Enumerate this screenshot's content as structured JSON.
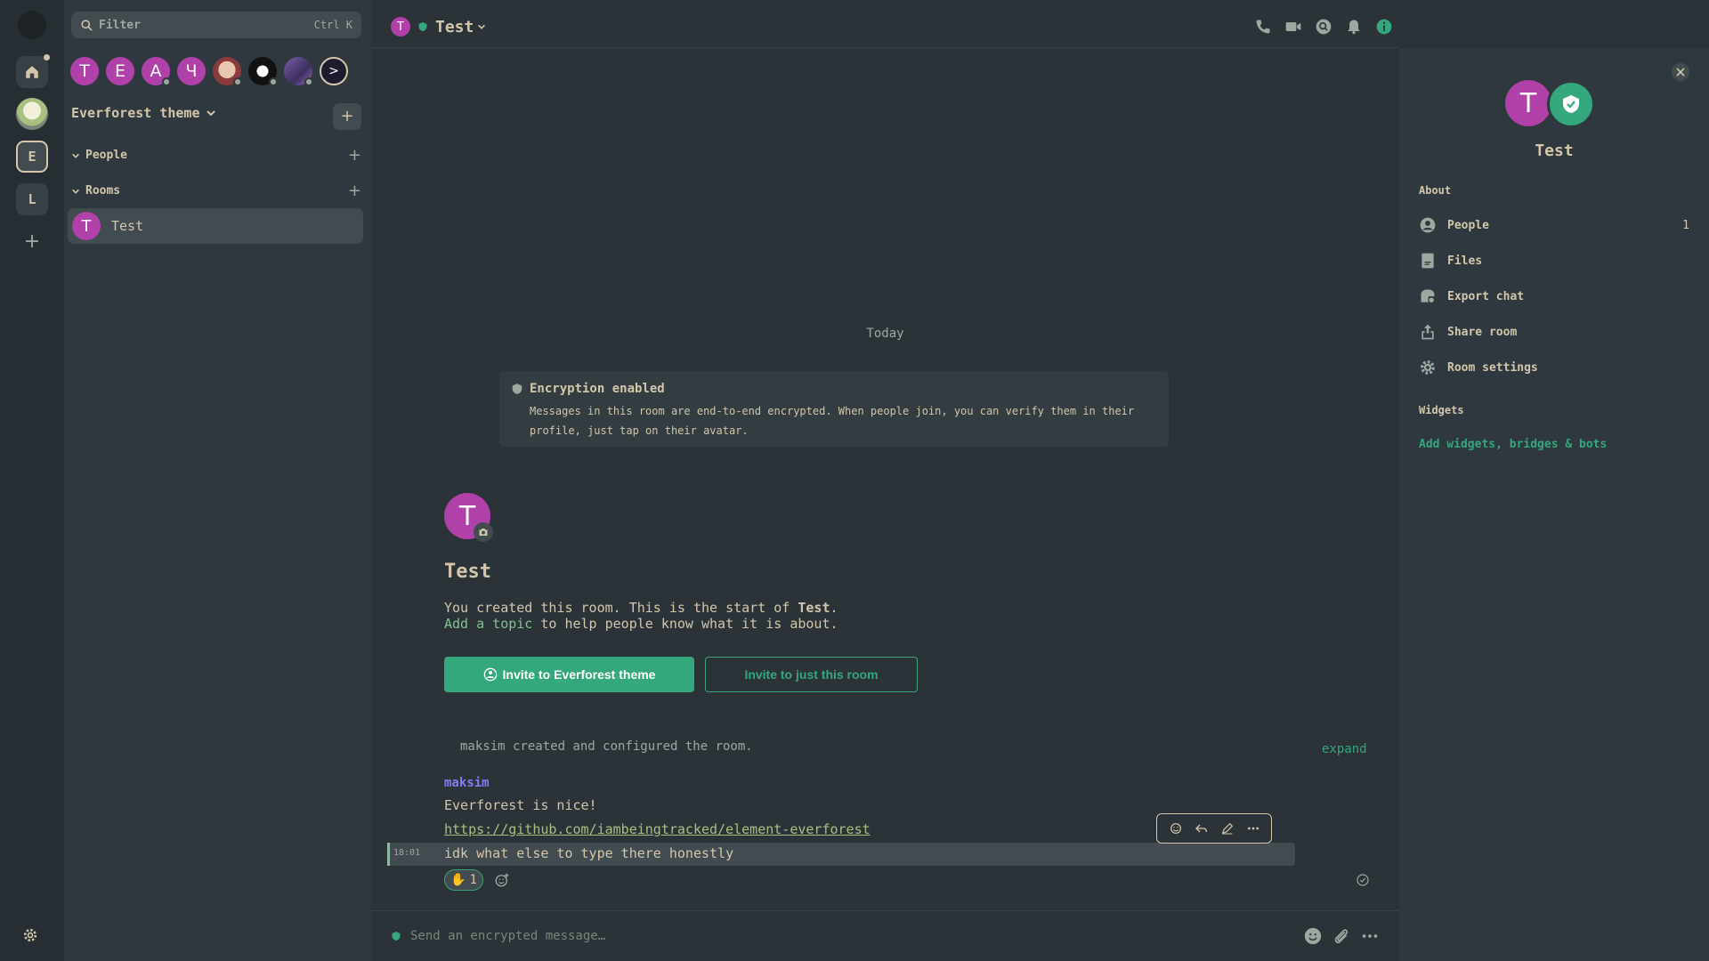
{
  "colors": {
    "accent": "#35a77c",
    "avatar": "#b041a9",
    "background": "#2b3339",
    "panel": "#2f383e",
    "sender": "#7f7ff0",
    "link": "#a7c080"
  },
  "spacebar": {
    "items": [
      {
        "icon": "home-icon"
      },
      {
        "icon": "space-avatar-image"
      },
      {
        "label": "E"
      },
      {
        "label": "L"
      }
    ]
  },
  "filter": {
    "placeholder": "Filter",
    "shortcut": "Ctrl K"
  },
  "recent_rooms": [
    "T",
    "E",
    "A",
    "Ч",
    "",
    "",
    "",
    ""
  ],
  "space": {
    "name": "Everforest theme"
  },
  "sections": {
    "people": "People",
    "rooms": "Rooms"
  },
  "room_list": [
    {
      "initial": "T",
      "name": "Test"
    }
  ],
  "header": {
    "initial": "T",
    "title": "Test"
  },
  "timeline": {
    "date_divider": "Today",
    "encryption": {
      "title": "Encryption enabled",
      "body": "Messages in this room are end-to-end encrypted. When people join, you can verify them in their profile, just tap on their avatar."
    },
    "intro": {
      "initial": "T",
      "room_name": "Test",
      "line1_prefix": "You created this room. This is the start of ",
      "line1_room": "Test",
      "line1_suffix": ".",
      "topic_link": "Add a topic",
      "line2_suffix": " to help people know what it is about."
    },
    "invite_space_button": "Invite to Everforest theme",
    "invite_room_button": "Invite to just this room",
    "created_summary": "maksim created and configured the room.",
    "expand_label": "expand",
    "messages": {
      "sender": "maksim",
      "lines": [
        "Everforest is nice!",
        "https://github.com/iambeingtracked/element-everforest",
        "idk what else to type there honestly"
      ],
      "timestamp": "18:01",
      "reaction": {
        "emoji": "✋",
        "count": "1"
      }
    }
  },
  "composer": {
    "placeholder": "Send an encrypted message…"
  },
  "right_panel": {
    "initial": "T",
    "room_name": "Test",
    "about_label": "About",
    "items": [
      {
        "label": "People",
        "count": "1",
        "icon": "person-icon"
      },
      {
        "label": "Files",
        "icon": "file-icon"
      },
      {
        "label": "Export chat",
        "icon": "export-icon"
      },
      {
        "label": "Share room",
        "icon": "share-icon"
      },
      {
        "label": "Room settings",
        "icon": "settings-icon"
      }
    ],
    "widgets_label": "Widgets",
    "add_widgets": "Add widgets, bridges & bots"
  }
}
